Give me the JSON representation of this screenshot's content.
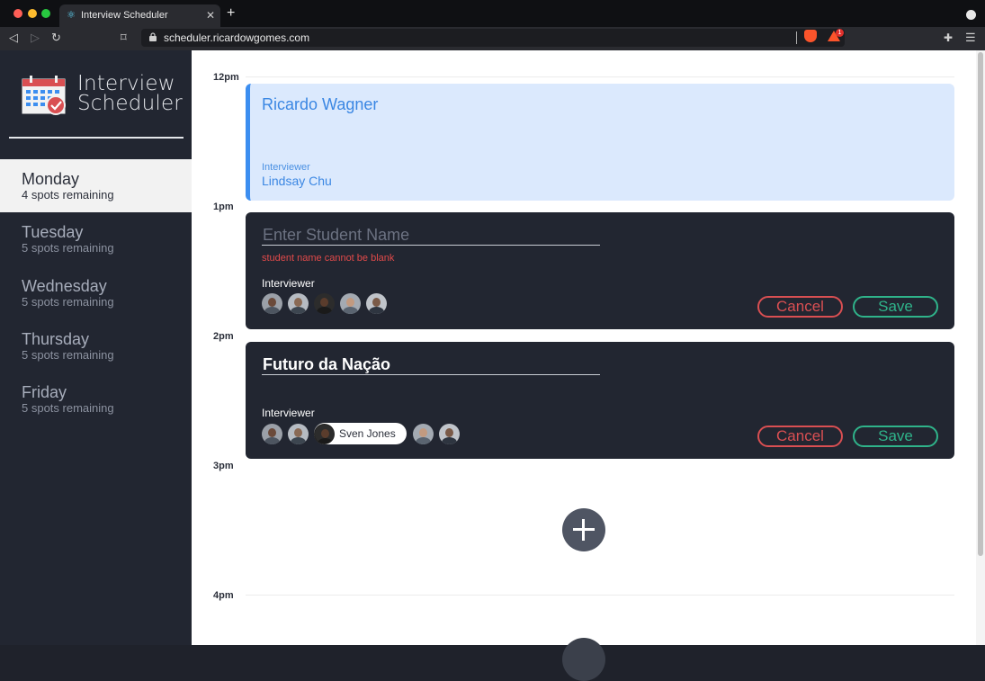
{
  "browser": {
    "tab_title": "Interview Scheduler",
    "url": "scheduler.ricardowgomes.com",
    "notification_count": "1"
  },
  "sidebar": {
    "logo_line1": "Interview",
    "logo_line2": "Scheduler",
    "days": [
      {
        "name": "Monday",
        "spots": "4 spots remaining",
        "selected": true
      },
      {
        "name": "Tuesday",
        "spots": "5 spots remaining",
        "selected": false
      },
      {
        "name": "Wednesday",
        "spots": "5 spots remaining",
        "selected": false
      },
      {
        "name": "Thursday",
        "spots": "5 spots remaining",
        "selected": false
      },
      {
        "name": "Friday",
        "spots": "5 spots remaining",
        "selected": false
      }
    ]
  },
  "schedule": {
    "times": [
      "12pm",
      "1pm",
      "2pm",
      "3pm",
      "4pm"
    ],
    "booked": {
      "student": "Ricardo Wagner",
      "interviewer_label": "Interviewer",
      "interviewer": "Lindsay Chu"
    },
    "form_new": {
      "placeholder": "Enter Student Name",
      "value": "",
      "error": "student name cannot be blank",
      "interviewer_label": "Interviewer",
      "cancel_label": "Cancel",
      "save_label": "Save"
    },
    "form_edit": {
      "placeholder": "Enter Student Name",
      "value": "Futuro da Nação",
      "interviewer_label": "Interviewer",
      "selected_interviewer": "Sven Jones",
      "cancel_label": "Cancel",
      "save_label": "Save"
    }
  },
  "colors": {
    "accent_blue": "#3c8ef0",
    "danger": "#d94f52",
    "confirm": "#2fb38a",
    "sidebar_bg": "#222631"
  }
}
